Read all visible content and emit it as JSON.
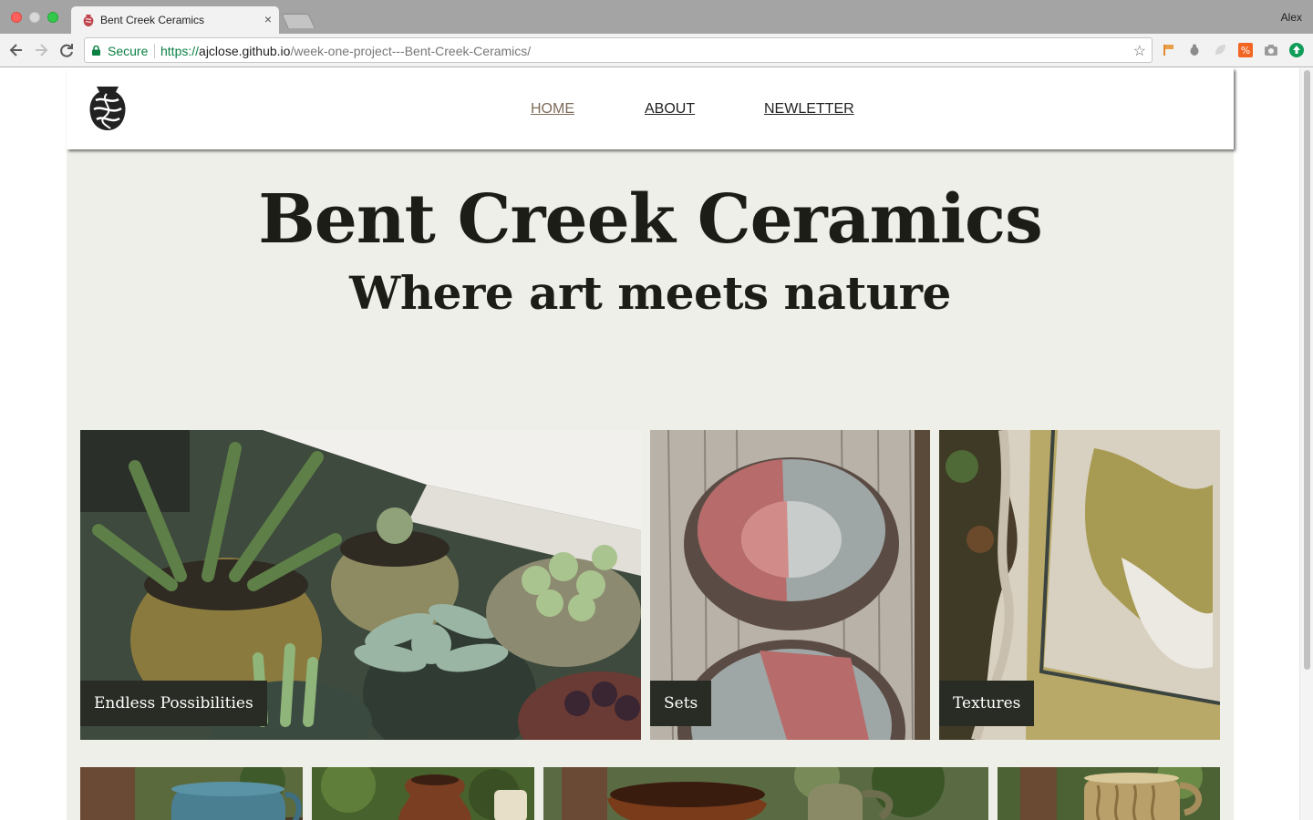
{
  "browser": {
    "tab_title": "Bent Creek Ceramics",
    "tab_close": "×",
    "profile_name": "Alex",
    "secure_label": "Secure",
    "url_scheme": "https://",
    "url_host": "ajclose.github.io",
    "url_path": "/week-one-project---Bent-Creek-Ceramics/"
  },
  "nav": {
    "home": "HOME",
    "about": "ABOUT",
    "newsletter": "NEWLETTER"
  },
  "hero": {
    "title": "Bent Creek Ceramics",
    "subtitle": "Where art meets nature"
  },
  "gallery": {
    "featured": [
      {
        "caption": "Endless Possibilities"
      },
      {
        "caption": "Sets"
      },
      {
        "caption": "Textures"
      }
    ]
  },
  "colors": {
    "page_background": "#eeefe8",
    "caption_background": "#292c24",
    "heading_text": "#1c1d17",
    "active_nav": "#7d6b58"
  }
}
